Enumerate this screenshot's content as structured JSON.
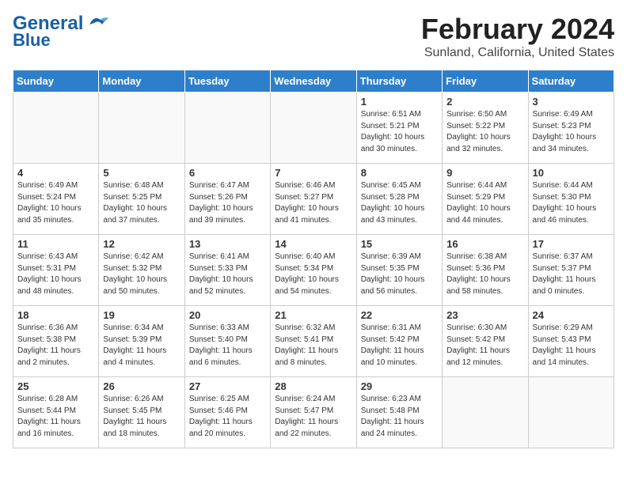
{
  "header": {
    "title": "February 2024",
    "location": "Sunland, California, United States"
  },
  "logo": {
    "line1": "General",
    "line2": "Blue"
  },
  "days_of_week": [
    "Sunday",
    "Monday",
    "Tuesday",
    "Wednesday",
    "Thursday",
    "Friday",
    "Saturday"
  ],
  "weeks": [
    [
      {
        "day": "",
        "info": ""
      },
      {
        "day": "",
        "info": ""
      },
      {
        "day": "",
        "info": ""
      },
      {
        "day": "",
        "info": ""
      },
      {
        "day": "1",
        "info": "Sunrise: 6:51 AM\nSunset: 5:21 PM\nDaylight: 10 hours\nand 30 minutes."
      },
      {
        "day": "2",
        "info": "Sunrise: 6:50 AM\nSunset: 5:22 PM\nDaylight: 10 hours\nand 32 minutes."
      },
      {
        "day": "3",
        "info": "Sunrise: 6:49 AM\nSunset: 5:23 PM\nDaylight: 10 hours\nand 34 minutes."
      }
    ],
    [
      {
        "day": "4",
        "info": "Sunrise: 6:49 AM\nSunset: 5:24 PM\nDaylight: 10 hours\nand 35 minutes."
      },
      {
        "day": "5",
        "info": "Sunrise: 6:48 AM\nSunset: 5:25 PM\nDaylight: 10 hours\nand 37 minutes."
      },
      {
        "day": "6",
        "info": "Sunrise: 6:47 AM\nSunset: 5:26 PM\nDaylight: 10 hours\nand 39 minutes."
      },
      {
        "day": "7",
        "info": "Sunrise: 6:46 AM\nSunset: 5:27 PM\nDaylight: 10 hours\nand 41 minutes."
      },
      {
        "day": "8",
        "info": "Sunrise: 6:45 AM\nSunset: 5:28 PM\nDaylight: 10 hours\nand 43 minutes."
      },
      {
        "day": "9",
        "info": "Sunrise: 6:44 AM\nSunset: 5:29 PM\nDaylight: 10 hours\nand 44 minutes."
      },
      {
        "day": "10",
        "info": "Sunrise: 6:44 AM\nSunset: 5:30 PM\nDaylight: 10 hours\nand 46 minutes."
      }
    ],
    [
      {
        "day": "11",
        "info": "Sunrise: 6:43 AM\nSunset: 5:31 PM\nDaylight: 10 hours\nand 48 minutes."
      },
      {
        "day": "12",
        "info": "Sunrise: 6:42 AM\nSunset: 5:32 PM\nDaylight: 10 hours\nand 50 minutes."
      },
      {
        "day": "13",
        "info": "Sunrise: 6:41 AM\nSunset: 5:33 PM\nDaylight: 10 hours\nand 52 minutes."
      },
      {
        "day": "14",
        "info": "Sunrise: 6:40 AM\nSunset: 5:34 PM\nDaylight: 10 hours\nand 54 minutes."
      },
      {
        "day": "15",
        "info": "Sunrise: 6:39 AM\nSunset: 5:35 PM\nDaylight: 10 hours\nand 56 minutes."
      },
      {
        "day": "16",
        "info": "Sunrise: 6:38 AM\nSunset: 5:36 PM\nDaylight: 10 hours\nand 58 minutes."
      },
      {
        "day": "17",
        "info": "Sunrise: 6:37 AM\nSunset: 5:37 PM\nDaylight: 11 hours\nand 0 minutes."
      }
    ],
    [
      {
        "day": "18",
        "info": "Sunrise: 6:36 AM\nSunset: 5:38 PM\nDaylight: 11 hours\nand 2 minutes."
      },
      {
        "day": "19",
        "info": "Sunrise: 6:34 AM\nSunset: 5:39 PM\nDaylight: 11 hours\nand 4 minutes."
      },
      {
        "day": "20",
        "info": "Sunrise: 6:33 AM\nSunset: 5:40 PM\nDaylight: 11 hours\nand 6 minutes."
      },
      {
        "day": "21",
        "info": "Sunrise: 6:32 AM\nSunset: 5:41 PM\nDaylight: 11 hours\nand 8 minutes."
      },
      {
        "day": "22",
        "info": "Sunrise: 6:31 AM\nSunset: 5:42 PM\nDaylight: 11 hours\nand 10 minutes."
      },
      {
        "day": "23",
        "info": "Sunrise: 6:30 AM\nSunset: 5:42 PM\nDaylight: 11 hours\nand 12 minutes."
      },
      {
        "day": "24",
        "info": "Sunrise: 6:29 AM\nSunset: 5:43 PM\nDaylight: 11 hours\nand 14 minutes."
      }
    ],
    [
      {
        "day": "25",
        "info": "Sunrise: 6:28 AM\nSunset: 5:44 PM\nDaylight: 11 hours\nand 16 minutes."
      },
      {
        "day": "26",
        "info": "Sunrise: 6:26 AM\nSunset: 5:45 PM\nDaylight: 11 hours\nand 18 minutes."
      },
      {
        "day": "27",
        "info": "Sunrise: 6:25 AM\nSunset: 5:46 PM\nDaylight: 11 hours\nand 20 minutes."
      },
      {
        "day": "28",
        "info": "Sunrise: 6:24 AM\nSunset: 5:47 PM\nDaylight: 11 hours\nand 22 minutes."
      },
      {
        "day": "29",
        "info": "Sunrise: 6:23 AM\nSunset: 5:48 PM\nDaylight: 11 hours\nand 24 minutes."
      },
      {
        "day": "",
        "info": ""
      },
      {
        "day": "",
        "info": ""
      }
    ]
  ]
}
